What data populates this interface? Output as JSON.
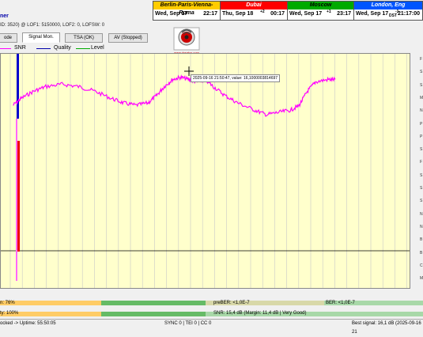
{
  "clocks": [
    {
      "name": "Berlin-Paris-Vienna-Roma",
      "day": "Wed, Sep 17",
      "time": "22:17",
      "offset": "",
      "header_bg": "#ffcc00",
      "header_fg": "#000000"
    },
    {
      "name": "Dubai",
      "day": "Thu, Sep 18",
      "time": "00:17",
      "offset": "+2",
      "header_bg": "#ff0000",
      "header_fg": "#ffffff"
    },
    {
      "name": "Moscow",
      "day": "Wed, Sep 17",
      "time": "23:17",
      "offset": "+1",
      "header_bg": "#00aa00",
      "header_fg": "#000000"
    },
    {
      "name": "London, Eng",
      "day": "Wed, Sep 17",
      "time": "21:17:00",
      "offset": "-1",
      "extra": "DST",
      "header_bg": "#0055ff",
      "header_fg": "#ffffff"
    }
  ],
  "title_fragment": "ner",
  "info_line": "ID: 3520) @ LOF1: 5150000, LOF2: 0, LOFSW: 0",
  "tabs": [
    {
      "label": "ode",
      "active": false
    },
    {
      "label": "Signal Mon.",
      "active": true
    },
    {
      "label": "TSA (OK)",
      "active": false
    },
    {
      "label": "AV (Stopped)",
      "active": false
    }
  ],
  "logo_text": "www.dxsatcs.com",
  "legend": [
    {
      "label": "SNR",
      "color": "#ff00ff"
    },
    {
      "label": "Quality",
      "color": "#0000aa"
    },
    {
      "label": "Level",
      "color": "#00aa00"
    }
  ],
  "tooltip": "2025-09-16 21:50:47, value: 16,1000003814697",
  "right_labels": [
    "F",
    "S",
    "S",
    "M",
    "N",
    "P",
    "P",
    "S",
    "F",
    "S",
    "S",
    "S",
    "N",
    "N",
    "B",
    "B",
    "C",
    "M"
  ],
  "chart_data": {
    "type": "line",
    "series": [
      {
        "name": "SNR",
        "color": "#ff00ff",
        "points": [
          [
            0.03,
            0.22
          ],
          [
            0.05,
            0.19
          ],
          [
            0.08,
            0.16
          ],
          [
            0.11,
            0.14
          ],
          [
            0.15,
            0.13
          ],
          [
            0.19,
            0.14
          ],
          [
            0.23,
            0.16
          ],
          [
            0.27,
            0.19
          ],
          [
            0.3,
            0.21
          ],
          [
            0.33,
            0.22
          ],
          [
            0.36,
            0.21
          ],
          [
            0.38,
            0.18
          ],
          [
            0.4,
            0.14
          ],
          [
            0.42,
            0.11
          ],
          [
            0.44,
            0.1
          ],
          [
            0.46,
            0.11
          ],
          [
            0.48,
            0.12
          ],
          [
            0.5,
            0.11
          ],
          [
            0.52,
            0.14
          ],
          [
            0.55,
            0.18
          ],
          [
            0.58,
            0.21
          ],
          [
            0.62,
            0.24
          ],
          [
            0.65,
            0.26
          ],
          [
            0.68,
            0.25
          ],
          [
            0.71,
            0.24
          ],
          [
            0.73,
            0.22
          ],
          [
            0.75,
            0.16
          ],
          [
            0.77,
            0.12
          ],
          [
            0.8,
            0.11
          ],
          [
            0.82,
            0.11
          ]
        ]
      }
    ]
  },
  "bottom": {
    "left_pct": "n: 76%",
    "quality_pct": "ty: 100%",
    "prober": "preBER: <1,0E-7",
    "snr_text": "SNR: 15,4 dB (Margin: 11,4 dB | Very Good)",
    "ber": "BER: <1,0E-7",
    "locked": "ocked -> Uptime: 55:50:05",
    "sync": "SYNC 0 | TEI 0 | CC 0",
    "best_signal": "Best signal: 16,1 dB (2025-09-16 21"
  }
}
